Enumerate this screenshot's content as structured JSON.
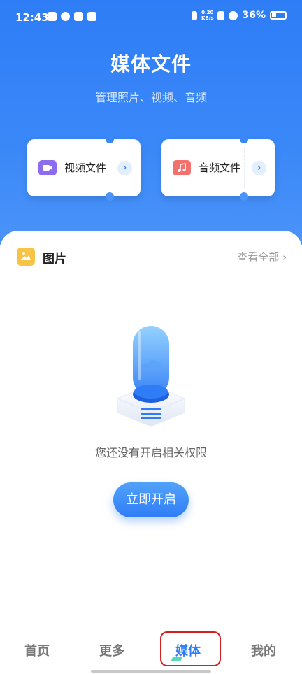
{
  "status_bar": {
    "time": "12:43",
    "net_speed_value": "0.20",
    "net_speed_unit": "KB/s",
    "battery": "36%"
  },
  "header": {
    "title": "媒体文件",
    "subtitle": "管理照片、视频、音频"
  },
  "cards": [
    {
      "label": "视频文件",
      "icon": "video-camera-icon",
      "icon_color": "#8e6cf0"
    },
    {
      "label": "音频文件",
      "icon": "music-note-icon",
      "icon_color": "#f4706c"
    }
  ],
  "pictures_section": {
    "title": "图片",
    "view_all": "查看全部 ›",
    "icon": "image-icon",
    "icon_color": "#f7c447"
  },
  "empty_state": {
    "message": "您还没有开启相关权限",
    "button_label": "立即开启"
  },
  "bottom_nav": {
    "items": [
      {
        "label": "首页"
      },
      {
        "label": "更多"
      },
      {
        "label": "媒体"
      },
      {
        "label": "我的"
      }
    ],
    "active_index": 2
  },
  "colors": {
    "primary": "#2f7df6",
    "highlight_box": "#d61f1f"
  }
}
